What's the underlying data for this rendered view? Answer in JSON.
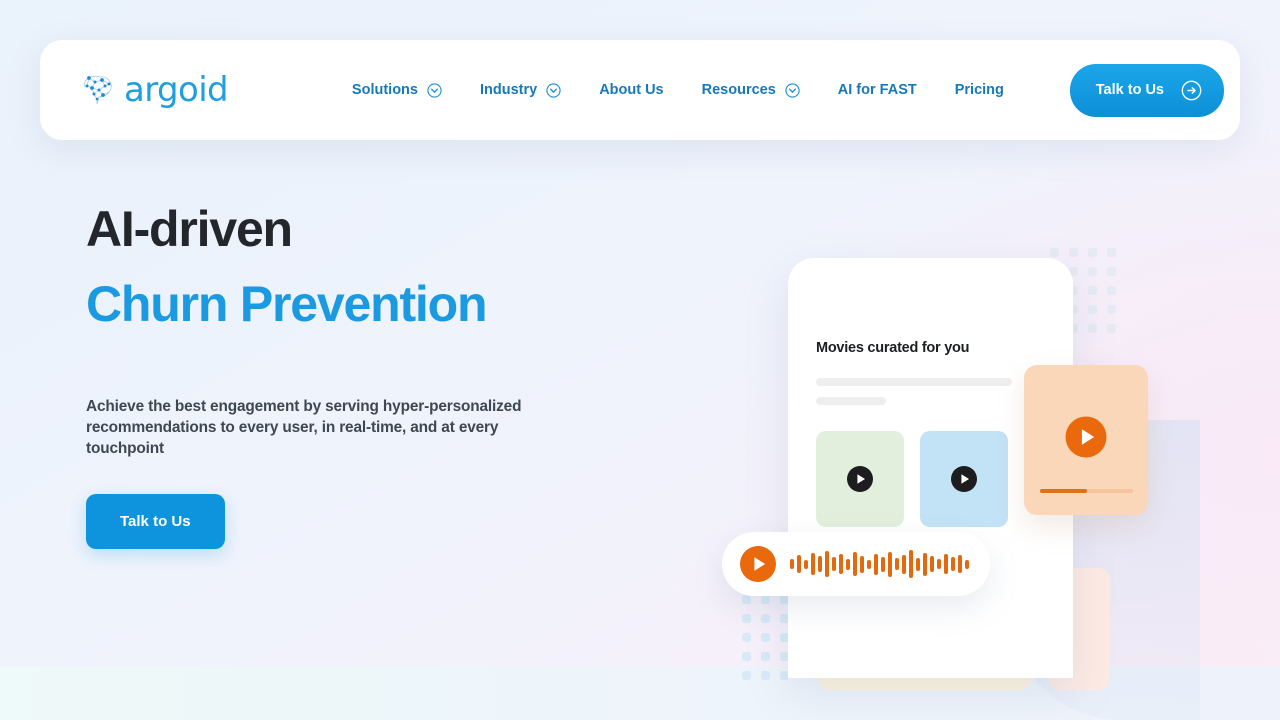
{
  "brand": {
    "name": "argoid",
    "logo_icon": "brain-network-icon",
    "accent_blue": "#1b9ae2",
    "accent_orange": "#e2690d",
    "heading_dark": "#23272c"
  },
  "header": {
    "nav": [
      {
        "label": "Solutions",
        "has_dropdown": true,
        "icon": "chevron-down-circle-icon"
      },
      {
        "label": "Industry",
        "has_dropdown": true,
        "icon": "chevron-down-circle-icon"
      },
      {
        "label": "About Us",
        "has_dropdown": false,
        "icon": ""
      },
      {
        "label": "Resources",
        "has_dropdown": true,
        "icon": "chevron-down-circle-icon"
      },
      {
        "label": "AI for FAST",
        "has_dropdown": false,
        "icon": ""
      },
      {
        "label": "Pricing",
        "has_dropdown": false,
        "icon": ""
      }
    ],
    "cta": {
      "label": "Talk to Us",
      "icon": "arrow-right-circle-icon"
    }
  },
  "hero": {
    "heading_line1": "AI-driven",
    "heading_line2": "Churn Prevention",
    "subtext": "Achieve the best engagement by serving hyper-personalized recommendations to every user, in real-time, and at every touchpoint",
    "cta_label": "Talk to Us"
  },
  "illustration": {
    "phone": {
      "title": "Movies curated for you",
      "cards": [
        {
          "name": "green-media-card",
          "color": "#e2efdd",
          "icon": "play-icon"
        },
        {
          "name": "blue-media-card",
          "color": "#c2e2f5",
          "icon": "play-icon"
        }
      ]
    },
    "floating_card": {
      "name": "orange-media-card",
      "color": "#fad7b9",
      "icon": "play-icon",
      "progress_percent": 50
    },
    "cream_card": {
      "color": "#fdf3e0",
      "icon": "play-icon"
    },
    "peach_card": {
      "color": "#fdeae3"
    },
    "audio_player": {
      "icon": "play-icon",
      "waveform_bars": [
        10,
        18,
        9,
        22,
        16,
        26,
        14,
        20,
        11,
        24,
        17,
        9,
        21,
        15,
        25,
        12,
        19,
        28,
        13,
        23,
        16,
        10,
        20,
        14,
        18,
        9
      ]
    },
    "decorations": [
      {
        "name": "dot-grid-top-right",
        "color": "#e6eaf4",
        "columns": 4,
        "rows": 5
      },
      {
        "name": "dot-grid-bottom-left",
        "color": "#d8eaf6",
        "columns": 3,
        "rows": 5
      }
    ]
  }
}
